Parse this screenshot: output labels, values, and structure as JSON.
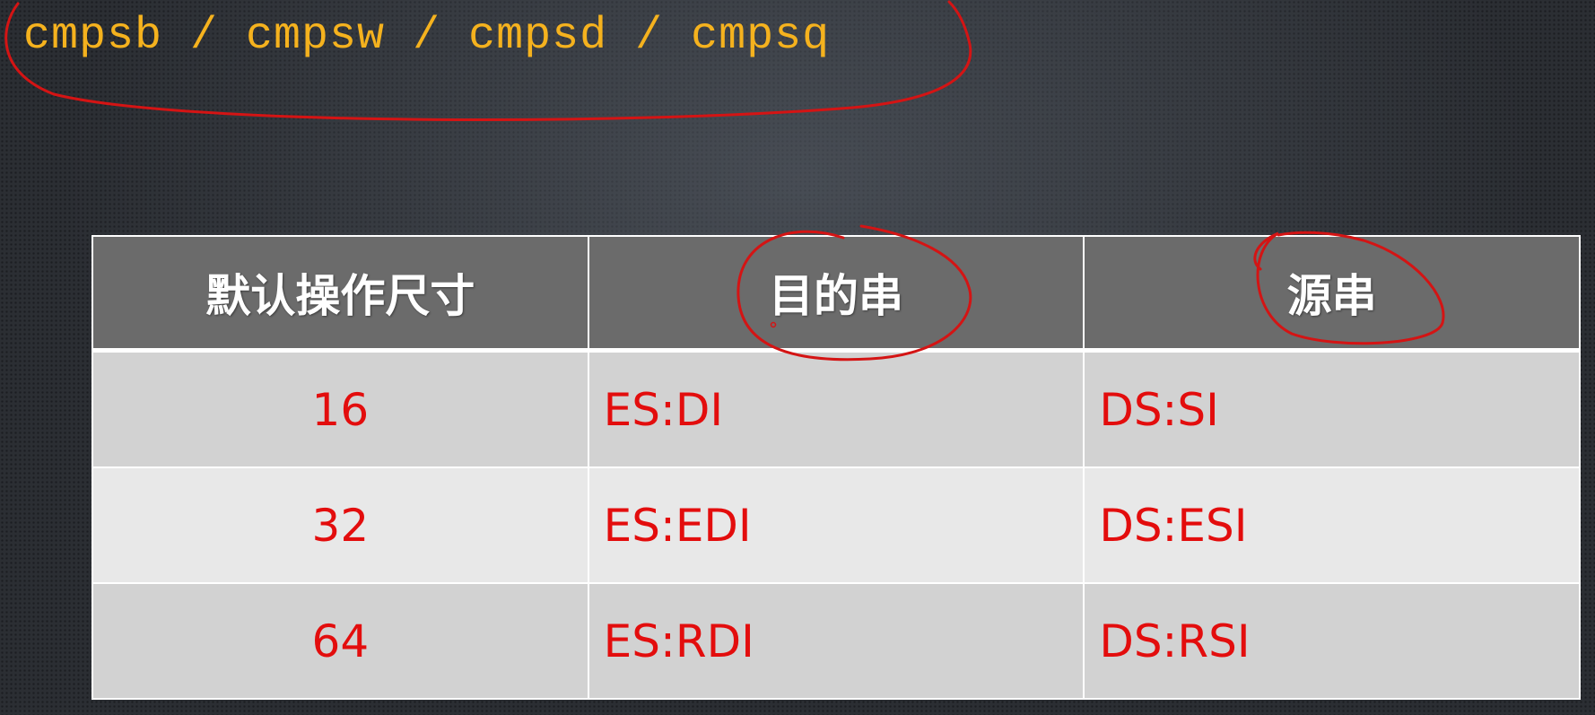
{
  "slide": {
    "title": "cmpsb / cmpsw / cmpsd / cmpsq"
  },
  "table": {
    "headers": [
      "默认操作尺寸",
      "目的串",
      "源串"
    ],
    "rows": [
      {
        "size": "16",
        "dest": "ES:DI",
        "src": "DS:SI"
      },
      {
        "size": "32",
        "dest": "ES:EDI",
        "src": "DS:ESI"
      },
      {
        "size": "64",
        "dest": "ES:RDI",
        "src": "DS:RSI"
      }
    ]
  },
  "colors": {
    "title": "#f5b21e",
    "cell_text": "#e30d0d",
    "header_bg": "#6b6b6b",
    "annotation": "#d41414"
  }
}
